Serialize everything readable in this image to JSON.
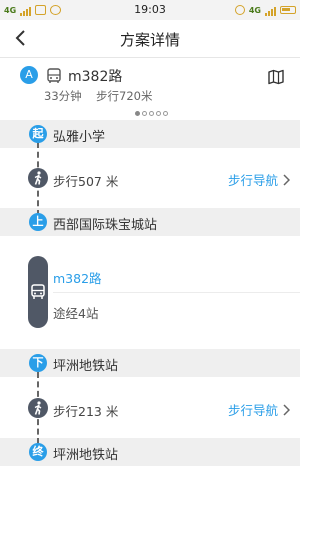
{
  "status_bar": {
    "network": "4G",
    "time": "19:03",
    "network_right": "4G"
  },
  "header": {
    "title": "方案详情"
  },
  "summary": {
    "plan_badge": "A",
    "route": "m382路",
    "duration": "33分钟",
    "walk_total": "步行720米",
    "page_dots": 5,
    "active_dot": 0
  },
  "timeline": {
    "start": {
      "badge": "起",
      "name": "弘雅小学"
    },
    "walk1": {
      "text": "步行507 米",
      "nav_label": "步行导航"
    },
    "board": {
      "badge": "上",
      "name": "西部国际珠宝城站"
    },
    "bus": {
      "line": "m382路",
      "stops": "途经4站"
    },
    "alight": {
      "badge": "下",
      "name": "坪洲地铁站"
    },
    "walk2": {
      "text": "步行213 米",
      "nav_label": "步行导航"
    },
    "end": {
      "badge": "终",
      "name": "坪洲地铁站"
    }
  },
  "colors": {
    "accent": "#2a9ee8",
    "node_dark": "#505866",
    "band": "#efefef"
  }
}
